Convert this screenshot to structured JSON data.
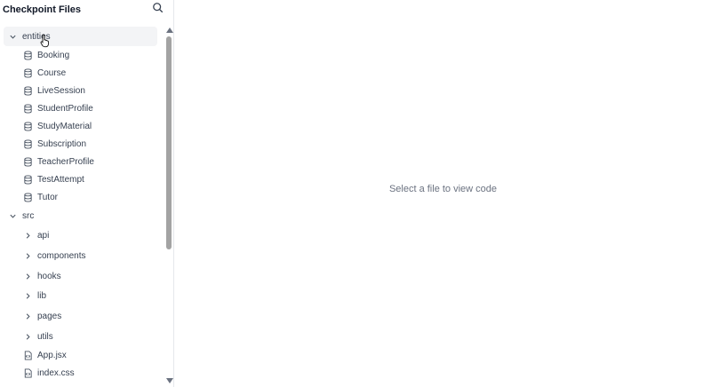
{
  "sidebar": {
    "title": "Checkpoint Files",
    "search_icon": "search-icon",
    "tree": {
      "entities": {
        "label": "entities",
        "expanded": true,
        "items": [
          "Booking",
          "Course",
          "LiveSession",
          "StudentProfile",
          "StudyMaterial",
          "Subscription",
          "TeacherProfile",
          "TestAttempt",
          "Tutor"
        ]
      },
      "src": {
        "label": "src",
        "expanded": true,
        "folders": [
          "api",
          "components",
          "hooks",
          "lib",
          "pages",
          "utils"
        ],
        "files": [
          "App.jsx",
          "index.css"
        ]
      }
    }
  },
  "main": {
    "placeholder": "Select a file to view code"
  },
  "colors": {
    "border": "#e5e7eb",
    "text": "#374151",
    "muted": "#6b7280",
    "selected_bg": "#f3f4f6"
  }
}
